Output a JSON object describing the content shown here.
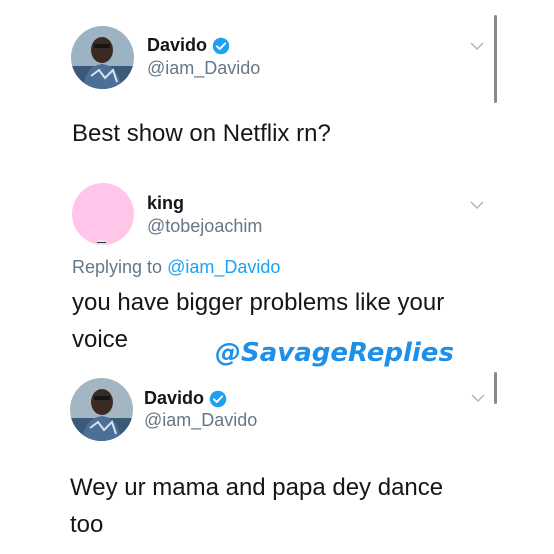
{
  "tweets": [
    {
      "name": "Davido",
      "handle": "@iam_Davido",
      "verified": true,
      "text": "Best show on Netflix rn?"
    },
    {
      "name": "king",
      "handle": "@tobejoachim",
      "verified": false,
      "reply_prefix": "Replying to ",
      "reply_to": "@iam_Davido",
      "text": "you have bigger problems like your voice"
    },
    {
      "name": "Davido",
      "handle": "@iam_Davido",
      "verified": true,
      "text": "Wey ur mama and papa dey dance too"
    }
  ],
  "watermark": "@SavageReplies",
  "colors": {
    "accent": "#1da1f2",
    "secondary_text": "#657786",
    "watermark": "#1e90e8",
    "pink_avatar": "#ffc6ea"
  },
  "icons": [
    "verified-badge-icon",
    "chevron-down-icon"
  ]
}
